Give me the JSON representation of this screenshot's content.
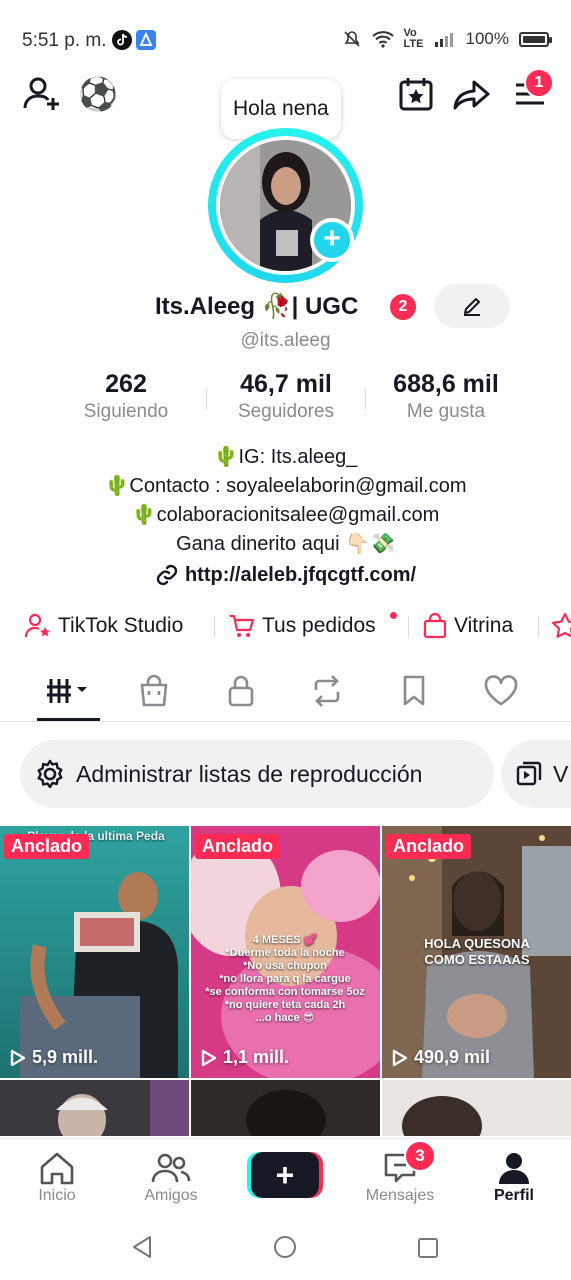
{
  "status_bar": {
    "time": "5:51 p. m.",
    "network": "Vo LTE",
    "battery": "100%",
    "battery_level": 1.0
  },
  "header": {
    "add_friend_icon": "add-user-icon",
    "ball_emoji": "⚽",
    "calendar_icon": "calendar-star-icon",
    "share_icon": "share-icon",
    "menu_icon": "menu-icon",
    "menu_badge": "1"
  },
  "profile": {
    "bubble_text": "Hola nena",
    "name": "Its.Aleeg 🥀| UGC",
    "name_badge": "2",
    "handle": "@its.aleeg"
  },
  "stats": [
    {
      "value": "262",
      "label": "Siguiendo"
    },
    {
      "value": "46,7 mil",
      "label": "Seguidores"
    },
    {
      "value": "688,6 mil",
      "label": "Me gusta"
    }
  ],
  "bio": {
    "lines": [
      "🌵IG: Its.aleeg_",
      "🌵Contacto : soyaleelaborin@gmail.com",
      "🌵colaboracionitsalee@gmail.com",
      "Gana dinerito aqui 👇🏻💸"
    ],
    "link": "http://aleleb.jfqcgtf.com/"
  },
  "quick_links": [
    {
      "label": "TikTok Studio",
      "icon": "person-star-icon"
    },
    {
      "label": "Tus pedidos",
      "icon": "cart-icon"
    },
    {
      "label": "Vitrina",
      "icon": "bag-icon"
    }
  ],
  "tabs": [
    "videos-grid-icon",
    "shop-bag-icon",
    "lock-icon",
    "repost-icon",
    "bookmark-icon",
    "heart-icon"
  ],
  "chips": [
    {
      "label": "Administrar listas de reproducción",
      "icon": "gear-icon"
    },
    {
      "label": "V",
      "icon": "playlist-icon"
    }
  ],
  "videos": [
    {
      "label": "Anclado",
      "views": "5,9 mill.",
      "caption": "Player de la ultima Peda"
    },
    {
      "label": "Anclado",
      "views": "1,1 mill.",
      "caption": "4 MESES 💕\n*Duerme toda la noche\n*No usa chupon\n*no llora para q la cargue\n*se conforma con tomarse 5oz\n*no quiere teta cada 2h\n...o hace 😎"
    },
    {
      "label": "Anclado",
      "views": "490,9 mil",
      "caption": "HOLA QUESONA\nCOMO ESTAAAS"
    }
  ],
  "bottom_nav": [
    {
      "label": "Inicio",
      "icon": "home-icon"
    },
    {
      "label": "Amigos",
      "icon": "friends-icon"
    },
    {
      "label": "",
      "icon": "plus-icon"
    },
    {
      "label": "Mensajes",
      "icon": "message-icon",
      "badge": "3"
    },
    {
      "label": "Perfil",
      "icon": "profile-icon"
    }
  ],
  "colors": {
    "accent": "#fe2c55",
    "cyan": "#25f4ee",
    "text": "#161823",
    "muted": "#8a8b91"
  }
}
